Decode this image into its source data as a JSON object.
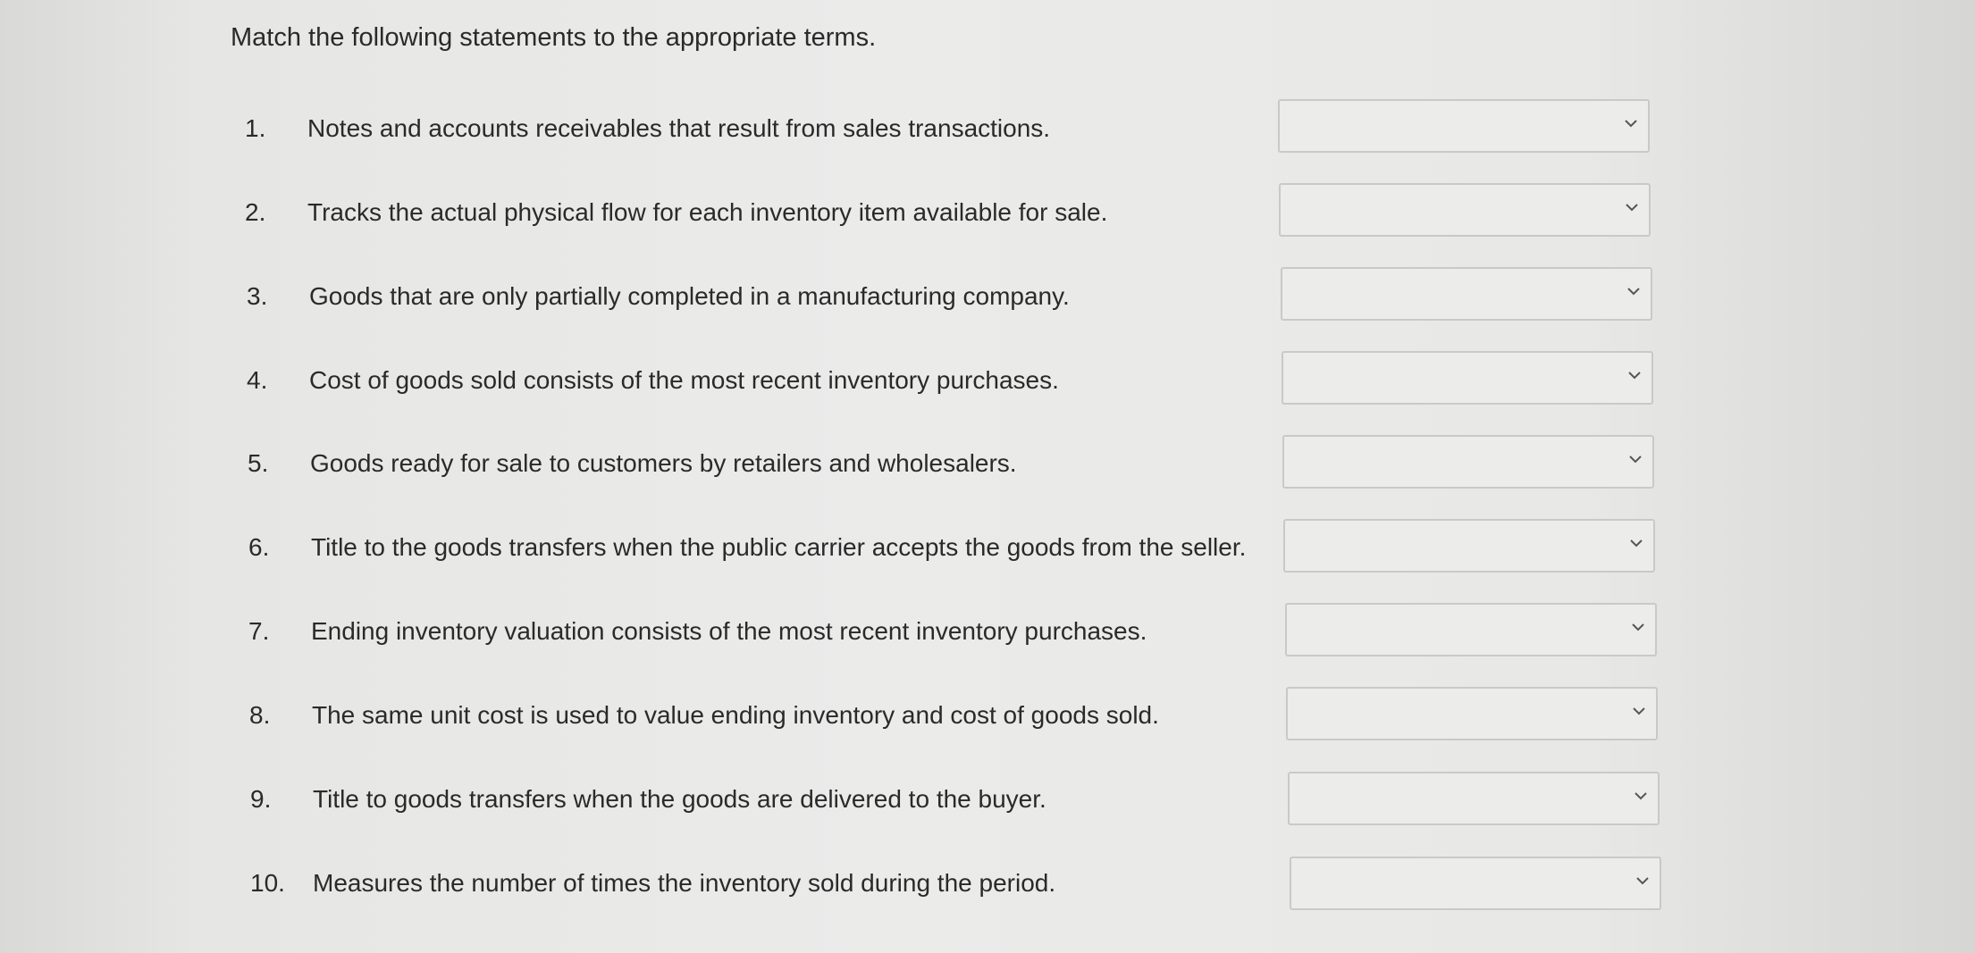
{
  "instruction": "Match the following statements to the appropriate terms.",
  "questions": [
    {
      "number": "1.",
      "text": "Notes and accounts receivables that result from sales transactions.",
      "selected": ""
    },
    {
      "number": "2.",
      "text": "Tracks the actual physical flow for each inventory item available for sale.",
      "selected": ""
    },
    {
      "number": "3.",
      "text": "Goods that are only partially completed in a manufacturing company.",
      "selected": ""
    },
    {
      "number": "4.",
      "text": "Cost of goods sold consists of the most recent inventory purchases.",
      "selected": ""
    },
    {
      "number": "5.",
      "text": "Goods ready for sale to customers by retailers and wholesalers.",
      "selected": ""
    },
    {
      "number": "6.",
      "text": "Title to the goods transfers when the public carrier accepts the goods from the seller.",
      "selected": ""
    },
    {
      "number": "7.",
      "text": "Ending inventory valuation consists of the most recent inventory purchases.",
      "selected": ""
    },
    {
      "number": "8.",
      "text": "The same unit cost is used to value ending inventory and cost of goods sold.",
      "selected": ""
    },
    {
      "number": "9.",
      "text": "Title to goods transfers when the goods are delivered to the buyer.",
      "selected": ""
    },
    {
      "number": "10.",
      "text": "Measures the number of times the inventory sold during the period.",
      "selected": ""
    }
  ],
  "icons": {
    "dropdown": "chevron-down-icon"
  },
  "colors": {
    "background": "#e8e8e6",
    "text": "#2a2a2a",
    "select_border": "#c9c9c7"
  }
}
